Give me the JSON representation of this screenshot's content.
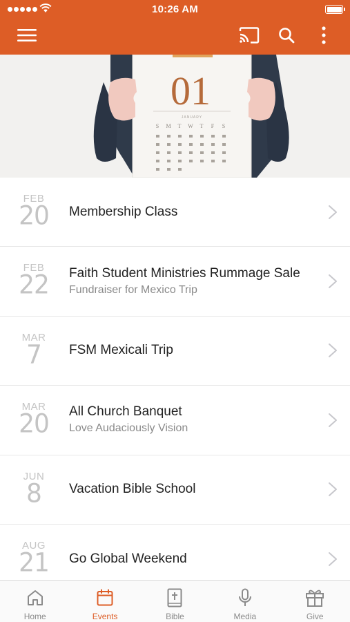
{
  "status_bar": {
    "time": "10:26 AM"
  },
  "colors": {
    "accent": "#dd5d26",
    "inactive": "#8a8a8a",
    "date": "#c4c4c4"
  },
  "header": {
    "icons": [
      "menu-icon",
      "cast-icon",
      "search-icon",
      "more-vertical-icon"
    ]
  },
  "hero": {
    "calendar_number": "01",
    "calendar_month": "JANUARY",
    "weekdays": [
      "S",
      "M",
      "T",
      "W",
      "T",
      "F",
      "S"
    ]
  },
  "events": [
    {
      "month": "FEB",
      "day": "20",
      "title": "Membership Class",
      "subtitle": ""
    },
    {
      "month": "FEB",
      "day": "22",
      "title": "Faith Student Ministries Rummage Sale",
      "subtitle": "Fundraiser for Mexico Trip"
    },
    {
      "month": "MAR",
      "day": "7",
      "title": "FSM Mexicali Trip",
      "subtitle": ""
    },
    {
      "month": "MAR",
      "day": "20",
      "title": "All Church Banquet",
      "subtitle": "Love Audaciously Vision"
    },
    {
      "month": "JUN",
      "day": "8",
      "title": "Vacation Bible School",
      "subtitle": ""
    },
    {
      "month": "AUG",
      "day": "21",
      "title": "Go Global Weekend",
      "subtitle": ""
    }
  ],
  "tabs": [
    {
      "label": "Home",
      "icon": "home-icon",
      "active": false
    },
    {
      "label": "Events",
      "icon": "calendar-icon",
      "active": true
    },
    {
      "label": "Bible",
      "icon": "bible-icon",
      "active": false
    },
    {
      "label": "Media",
      "icon": "microphone-icon",
      "active": false
    },
    {
      "label": "Give",
      "icon": "gift-icon",
      "active": false
    }
  ]
}
